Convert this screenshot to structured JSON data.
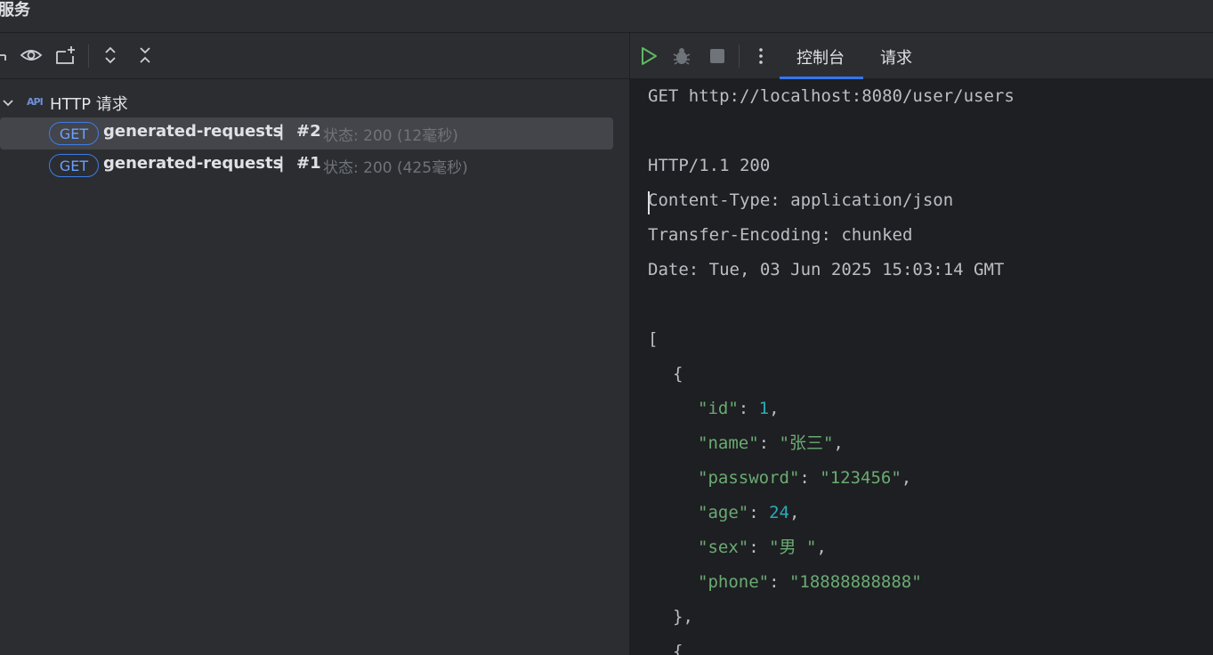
{
  "window": {
    "title": "服务"
  },
  "left_toolbar": {
    "icons": [
      "expand-icon",
      "eye-icon",
      "new-tab-icon",
      "expand-all-icon",
      "collapse-all-icon"
    ]
  },
  "tree": {
    "group_label": "HTTP 请求",
    "group_icon_text": "API",
    "requests": [
      {
        "method": "GET",
        "name": "generated-requests",
        "sep": "|",
        "num": "#2",
        "status": "状态: 200 (12毫秒)",
        "selected": true
      },
      {
        "method": "GET",
        "name": "generated-requests",
        "sep": "|",
        "num": "#1",
        "status": "状态: 200 (425毫秒)",
        "selected": false
      }
    ]
  },
  "right_toolbar": {
    "tabs": [
      "控制台",
      "请求"
    ],
    "active_tab": "控制台"
  },
  "console": {
    "request_line": "GET http://localhost:8080/user/users",
    "status_line": "HTTP/1.1 200",
    "headers": [
      "Content-Type: application/json",
      "Transfer-Encoding: chunked",
      "Date: Tue, 03 Jun 2025 15:03:14 GMT"
    ],
    "open_bracket": "[",
    "open_brace": "{",
    "fields": [
      {
        "key": "\"id\"",
        "value": "1",
        "type": "num",
        "comma": ","
      },
      {
        "key": "\"name\"",
        "value": "\"张三\"",
        "type": "str",
        "comma": ","
      },
      {
        "key": "\"password\"",
        "value": "\"123456\"",
        "type": "str",
        "comma": ","
      },
      {
        "key": "\"age\"",
        "value": "24",
        "type": "num",
        "comma": ","
      },
      {
        "key": "\"sex\"",
        "value": "\"男 \"",
        "type": "str",
        "comma": ","
      },
      {
        "key": "\"phone\"",
        "value": "\"18888888888\"",
        "type": "str",
        "comma": ""
      }
    ],
    "close_brace": "},",
    "next_brace": "{"
  },
  "colors": {
    "accent": "#3574f0",
    "badge": "#3d7ce6",
    "json_string": "#6aab73",
    "json_number": "#2aacb8",
    "run_green": "#5fb865"
  }
}
